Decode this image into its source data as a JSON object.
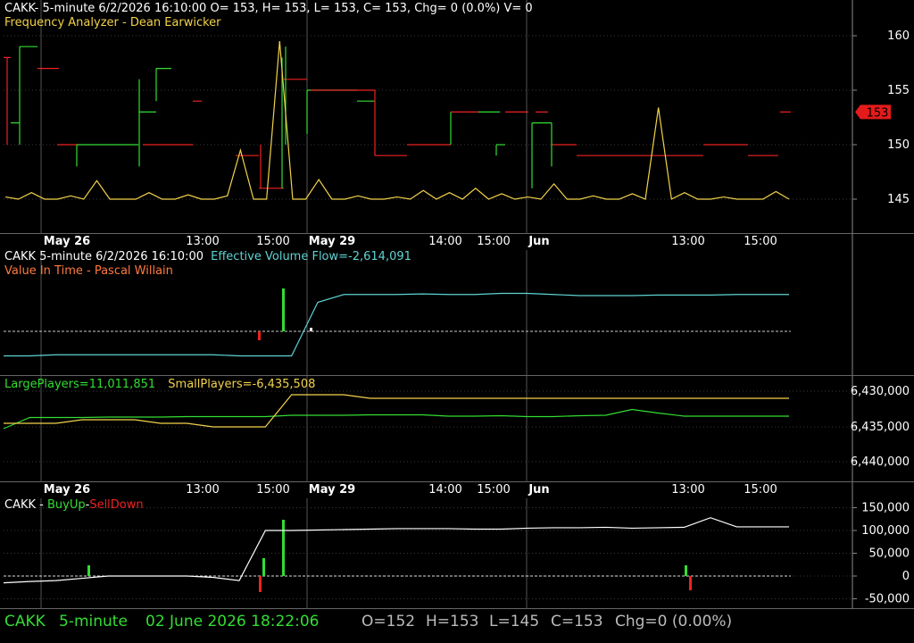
{
  "colors": {
    "green": "#33dd33",
    "red": "#ee2222",
    "yellow": "#f2d24a",
    "white": "#ffffff",
    "cyan": "#5fd3d3",
    "orange": "#ff7a3d",
    "grid": "#444444",
    "badge": "#e51b1b"
  },
  "panels": {
    "price": {
      "title_line": "CAKK- 5-minute 6/2/2026 16:10:00 O= 153, H= 153, L= 153, C= 153, Chg= 0 (0.0%) V= 0",
      "indicator_name": "Frequency Analyzer",
      "indicator_sep": " - ",
      "indicator_author": "Dean Earwicker",
      "last_price_badge": "153"
    },
    "volume_flow": {
      "title": "CAKK 5-minute  6/2/2026 16:10:00",
      "efv_label": "Effective Volume Flow=-2,614,091",
      "indicator_name": "Value In Time",
      "indicator_sep": " - ",
      "indicator_author": "Pascal Willain"
    },
    "players": {
      "large_label": "LargePlayers=11,011,851",
      "small_label": "SmallPlayers=-6,435,508"
    },
    "buy_sell": {
      "prefix": "CAKK - ",
      "buy": "BuyUp",
      "dash": "-",
      "sell": "SellDown"
    }
  },
  "time_axis": [
    "May 26",
    "13:00",
    "15:00",
    "May 29",
    "14:00",
    "15:00",
    "Jun",
    "13:00",
    "15:00"
  ],
  "status_bar": {
    "symbol": "CAKK",
    "interval": "5-minute",
    "datetime": "02 June 2026 18:22:06",
    "open": "O=152",
    "high": "H=153",
    "low": "L=145",
    "close": "C=153",
    "change": "Chg=0 (0.00%)"
  },
  "chart_data": [
    {
      "type": "line",
      "panel": "price",
      "yticks": [
        "160",
        "155",
        "150",
        "145"
      ],
      "ylim": [
        142,
        163
      ],
      "series": [
        {
          "name": "Frequency Analyzer",
          "values": [
            145.2,
            145,
            145.6,
            145,
            145,
            145.3,
            145,
            146.7,
            145,
            145,
            145,
            145.6,
            145,
            145,
            145.4,
            145,
            145,
            145.3,
            149.5,
            145,
            145,
            159.5,
            145,
            145,
            146.8,
            145,
            145,
            145.3,
            145,
            145,
            145.2,
            145,
            145.8,
            145,
            145.6,
            145,
            146,
            145,
            145.5,
            145,
            145.2,
            145,
            146.4,
            145,
            145,
            145.3,
            145,
            145,
            145.5,
            145,
            153.4,
            145,
            145.6,
            145,
            145,
            145.2,
            145,
            145,
            145,
            145.7,
            145
          ]
        }
      ]
    },
    {
      "type": "line",
      "panel": "volume_flow",
      "series": [
        {
          "name": "Effective Volume Flow",
          "values": [
            -2.2,
            -2.2,
            -2.1,
            -2.1,
            -2.1,
            -2.1,
            -2.1,
            -2.1,
            -2.1,
            -2.2,
            -2.2,
            -2.2,
            2.6,
            3.3,
            3.3,
            3.3,
            3.35,
            3.3,
            3.3,
            3.4,
            3.4,
            3.3,
            3.2,
            3.2,
            3.2,
            3.25,
            3.25,
            3.25,
            3.3,
            3.3,
            3.3
          ]
        }
      ]
    },
    {
      "type": "line",
      "panel": "players",
      "yticks": [
        "6,430,000",
        "6,435,000",
        "6,440,000"
      ],
      "series": [
        {
          "name": "LargePlayers",
          "values": [
            -2.2,
            0.3,
            0.3,
            0.3,
            0.4,
            0.4,
            0.4,
            0.5,
            0.5,
            0.5,
            0.5,
            0.8,
            0.8,
            0.8,
            0.9,
            0.9,
            0.9,
            0.6,
            0.6,
            0.7,
            0.5,
            0.5,
            0.7,
            0.8,
            2.1,
            1.3,
            0.6,
            0.6,
            0.6,
            0.6,
            0.6
          ]
        },
        {
          "name": "SmallPlayers",
          "values": [
            -1.4,
            -1.4,
            -1.4,
            -1.5,
            -1.5,
            -1.5,
            -1.4,
            -1.4,
            -1.3,
            -1.3,
            -1.3,
            -2.2,
            -2.2,
            -2.2,
            -2.1,
            -2.1,
            -2.1,
            -2.1,
            -2.1,
            -2.1,
            -2.1,
            -2.1,
            -2.1,
            -2.1,
            -2.1,
            -2.1,
            -2.1,
            -2.1,
            -2.1,
            -2.1,
            -2.1
          ]
        }
      ]
    },
    {
      "type": "bar",
      "panel": "buy_sell",
      "yticks": [
        "150,000",
        "100,000",
        "50,000",
        "0",
        "-50,000"
      ],
      "ylim": [
        -65000,
        160000
      ],
      "series": [
        {
          "name": "cumulative",
          "values": [
            -15000,
            -12000,
            -10000,
            -5000,
            0,
            0,
            0,
            0,
            -3000,
            -10000,
            100000,
            100000,
            101000,
            102000,
            103000,
            104000,
            104000,
            104000,
            103000,
            103000,
            105000,
            106000,
            106000,
            107000,
            105000,
            106000,
            107000,
            128000,
            108000,
            108000,
            108000
          ]
        }
      ]
    }
  ]
}
